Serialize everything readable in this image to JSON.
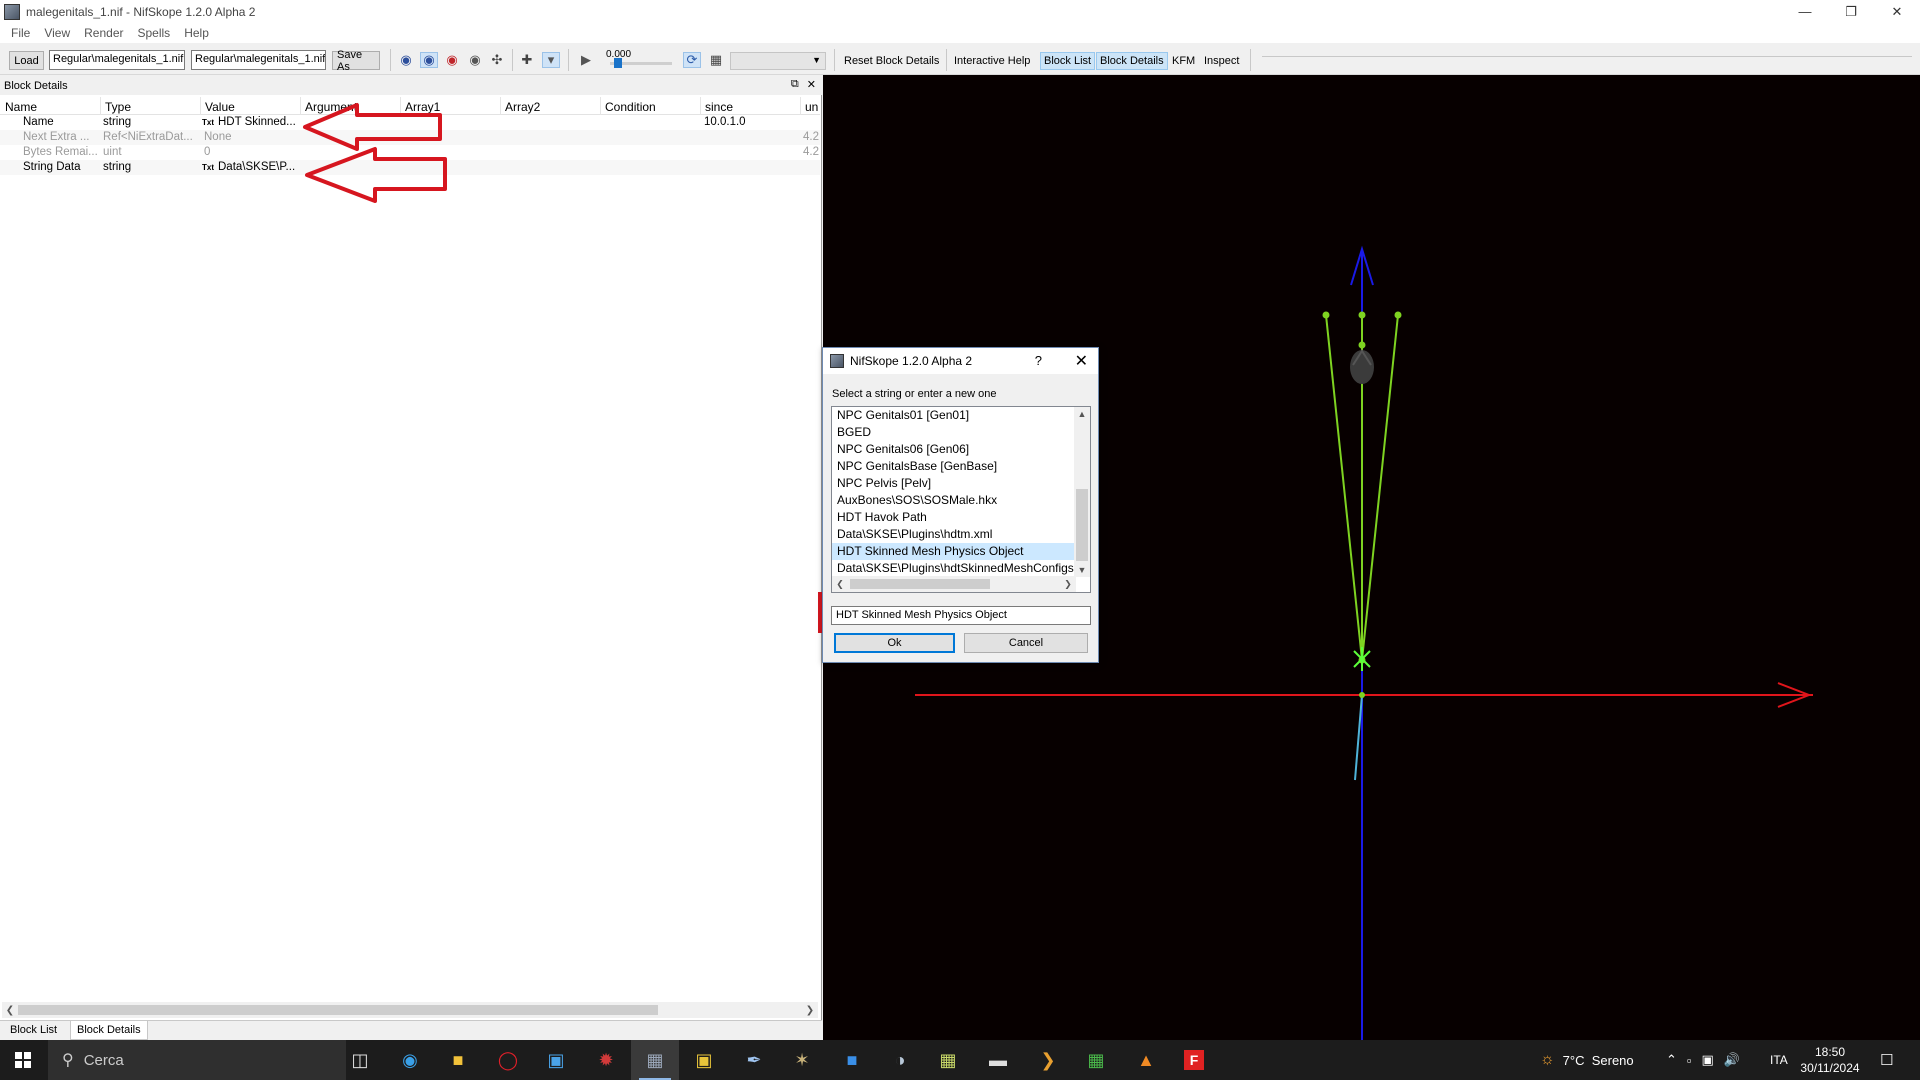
{
  "window": {
    "title": "malegenitals_1.nif - NifSkope 1.2.0 Alpha 2",
    "controls": [
      "minimize-icon",
      "restore-icon",
      "close-icon"
    ]
  },
  "menu": [
    "File",
    "View",
    "Render",
    "Spells",
    "Help"
  ],
  "toolbar": {
    "load_label": "Load",
    "load_path": "Regular\\malegenitals_1.nif",
    "save_path": "Regular\\malegenitals_1.nif",
    "save_as_label": "Save As",
    "time_value": "0.000",
    "reset_block_details": "Reset Block Details",
    "interactive_help": "Interactive Help",
    "block_list": "Block List",
    "block_details": "Block Details",
    "kfm": "KFM",
    "inspect": "Inspect"
  },
  "block_details": {
    "title": "Block Details",
    "columns": [
      "Name",
      "Type",
      "Value",
      "Argument",
      "Array1",
      "Array2",
      "Condition",
      "since",
      "un"
    ],
    "rows": [
      {
        "name": "Name",
        "type": "string",
        "value": "HDT Skinned...",
        "since": "10.0.1.0",
        "until": "",
        "tag": "Txt",
        "dim": false
      },
      {
        "name": "Next Extra ...",
        "type": "Ref<NiExtraDat...",
        "value": "None",
        "since": "",
        "until": "4.2",
        "tag": "",
        "dim": true
      },
      {
        "name": "Bytes Remai...",
        "type": "uint",
        "value": "0",
        "since": "",
        "until": "4.2",
        "tag": "",
        "dim": true
      },
      {
        "name": "String Data",
        "type": "string",
        "value": "Data\\SKSE\\P...",
        "since": "",
        "until": "",
        "tag": "Txt",
        "dim": false
      }
    ]
  },
  "bottom_tabs": [
    "Block List",
    "Block Details"
  ],
  "dialog": {
    "title": "NifSkope 1.2.0 Alpha 2",
    "help": "?",
    "prompt": "Select a string or enter a new one",
    "items": [
      "NPC Genitals01 [Gen01]",
      "BGED",
      "NPC Genitals06 [Gen06]",
      "NPC GenitalsBase [GenBase]",
      "NPC Pelvis [Pelv]",
      "AuxBones\\SOS\\SOSMale.hkx",
      "HDT Havok Path",
      "Data\\SKSE\\Plugins\\hdtm.xml",
      "HDT Skinned Mesh Physics Object",
      "Data\\SKSE\\Plugins\\hdtSkinnedMeshConfigs"
    ],
    "selected_index": 8,
    "input_value": "HDT Skinned Mesh Physics Object",
    "ok_label": "Ok",
    "cancel_label": "Cancel"
  },
  "taskbar": {
    "search_placeholder": "Cerca",
    "weather": "7°C  Sereno",
    "language": "ITA",
    "time": "18:50",
    "date": "30/11/2024"
  },
  "colors": {
    "viewport_bg": "#070000",
    "axis_x": "#e0151b",
    "axis_y": "#1a1ae6",
    "bones": "#7ed321",
    "annotation_red": "#d6161f"
  }
}
